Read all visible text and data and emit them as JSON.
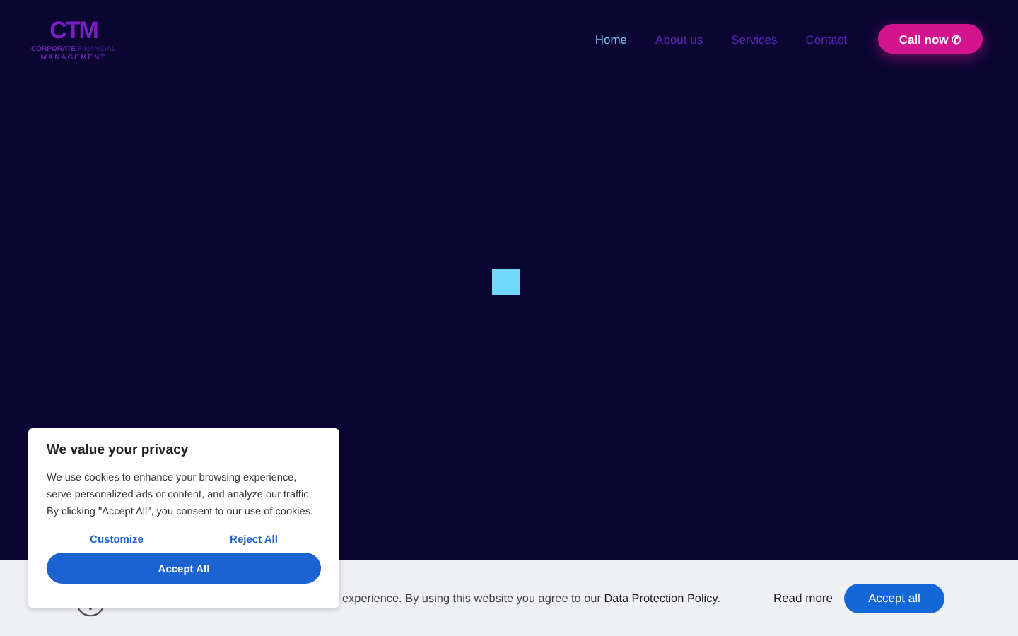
{
  "logo": {
    "mark": "CTM",
    "line_1": "CORPORATE",
    "line_1_dim": "FINANCIAL",
    "line_2": "MANAGEMENT"
  },
  "nav": [
    {
      "label": "Home",
      "selected": true
    },
    {
      "label": "About us",
      "selected": false
    },
    {
      "label": "Services",
      "selected": false
    },
    {
      "label": "Contact",
      "selected": false
    }
  ],
  "call_button": {
    "label": "Call now",
    "icon": "✆"
  },
  "cookie_banner": {
    "text": "experience. By using this website you agree to our **Data Protection Policy**.",
    "read_more": "Read more",
    "accept": "Accept all"
  },
  "privacy_modal": {
    "title": "We value your privacy",
    "text": "We use cookies to enhance your browsing experience, serve personalized ads or content, and analyze our traffic. By clicking \"Accept All\", you consent to our use of cookies.",
    "customize": "Customize",
    "reject": "Reject All",
    "accept": "Accept All"
  }
}
